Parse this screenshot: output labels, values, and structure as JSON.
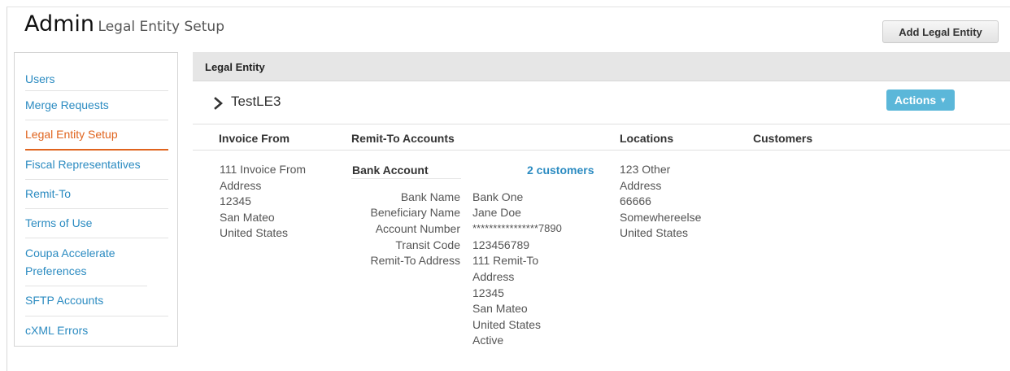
{
  "header": {
    "title": "Admin",
    "subtitle": "Legal Entity Setup",
    "add_button": "Add Legal Entity"
  },
  "sidebar": {
    "items": [
      {
        "label": "Users"
      },
      {
        "label": "Merge Requests"
      },
      {
        "label": "Legal Entity Setup",
        "active": true
      },
      {
        "label": "Fiscal Representatives"
      },
      {
        "label": "Remit-To"
      },
      {
        "label": "Terms of Use"
      },
      {
        "label": "Coupa Accelerate Preferences"
      },
      {
        "label": "SFTP Accounts"
      },
      {
        "label": "cXML Errors"
      }
    ]
  },
  "panel": {
    "heading": "Legal Entity",
    "entity_name": "TestLE3",
    "actions_label": "Actions",
    "columns": [
      "Invoice From",
      "Remit-To Accounts",
      "Locations",
      "Customers"
    ],
    "invoice_from": [
      "111 Invoice From",
      "Address",
      "12345",
      "San Mateo",
      "United States"
    ],
    "remit_to": {
      "section_label": "Bank Account",
      "customers_link": "2 customers",
      "fields": [
        {
          "label": "Bank Name",
          "value": "Bank One"
        },
        {
          "label": "Beneficiary Name",
          "value": "Jane Doe"
        },
        {
          "label": "Account Number",
          "value": "****************7890"
        },
        {
          "label": "Transit Code",
          "value": "123456789"
        },
        {
          "label": "Remit-To Address",
          "value": "111 Remit-To"
        }
      ],
      "address_extra": [
        "Address",
        "12345",
        "San Mateo",
        "United States",
        "Active"
      ]
    },
    "locations": [
      "123 Other",
      "Address",
      "66666",
      "Somewhereelse",
      "United States"
    ]
  },
  "colors": {
    "link": "#2b8bc1",
    "active": "#e0641e",
    "actions_button": "#5bb7d9"
  }
}
